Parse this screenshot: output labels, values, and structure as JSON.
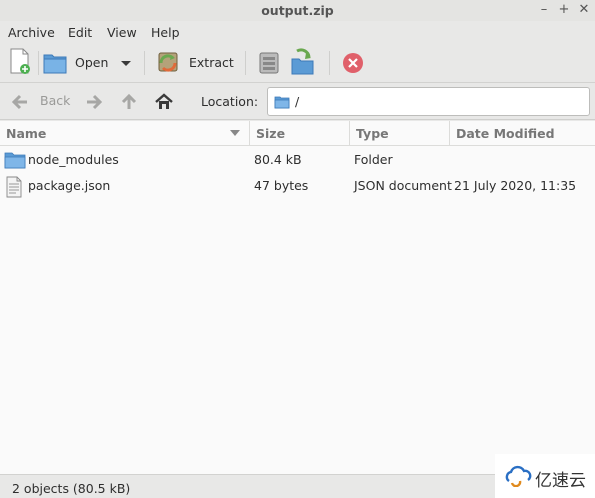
{
  "window": {
    "title": "output.zip"
  },
  "menubar": {
    "items": [
      "Archive",
      "Edit",
      "View",
      "Help"
    ]
  },
  "toolbar": {
    "open_label": "Open",
    "extract_label": "Extract"
  },
  "navigation": {
    "back_label": "Back",
    "location_label": "Location:",
    "location_value": "/"
  },
  "columns": [
    "Name",
    "Size",
    "Type",
    "Date Modified"
  ],
  "files": [
    {
      "name": "node_modules",
      "size": "80.4 kB",
      "type": "Folder",
      "date": "",
      "icon": "folder-icon"
    },
    {
      "name": "package.json",
      "size": "47 bytes",
      "type": "JSON document",
      "date": "21 July 2020, 11:35",
      "icon": "document-icon"
    }
  ],
  "status": {
    "text": "2 objects (80.5 kB)"
  },
  "watermark": {
    "text": "亿速云"
  },
  "colors": {
    "folder": "#5b9bd5",
    "extract_green": "#6aa84f",
    "stop_red": "#e0606a"
  }
}
